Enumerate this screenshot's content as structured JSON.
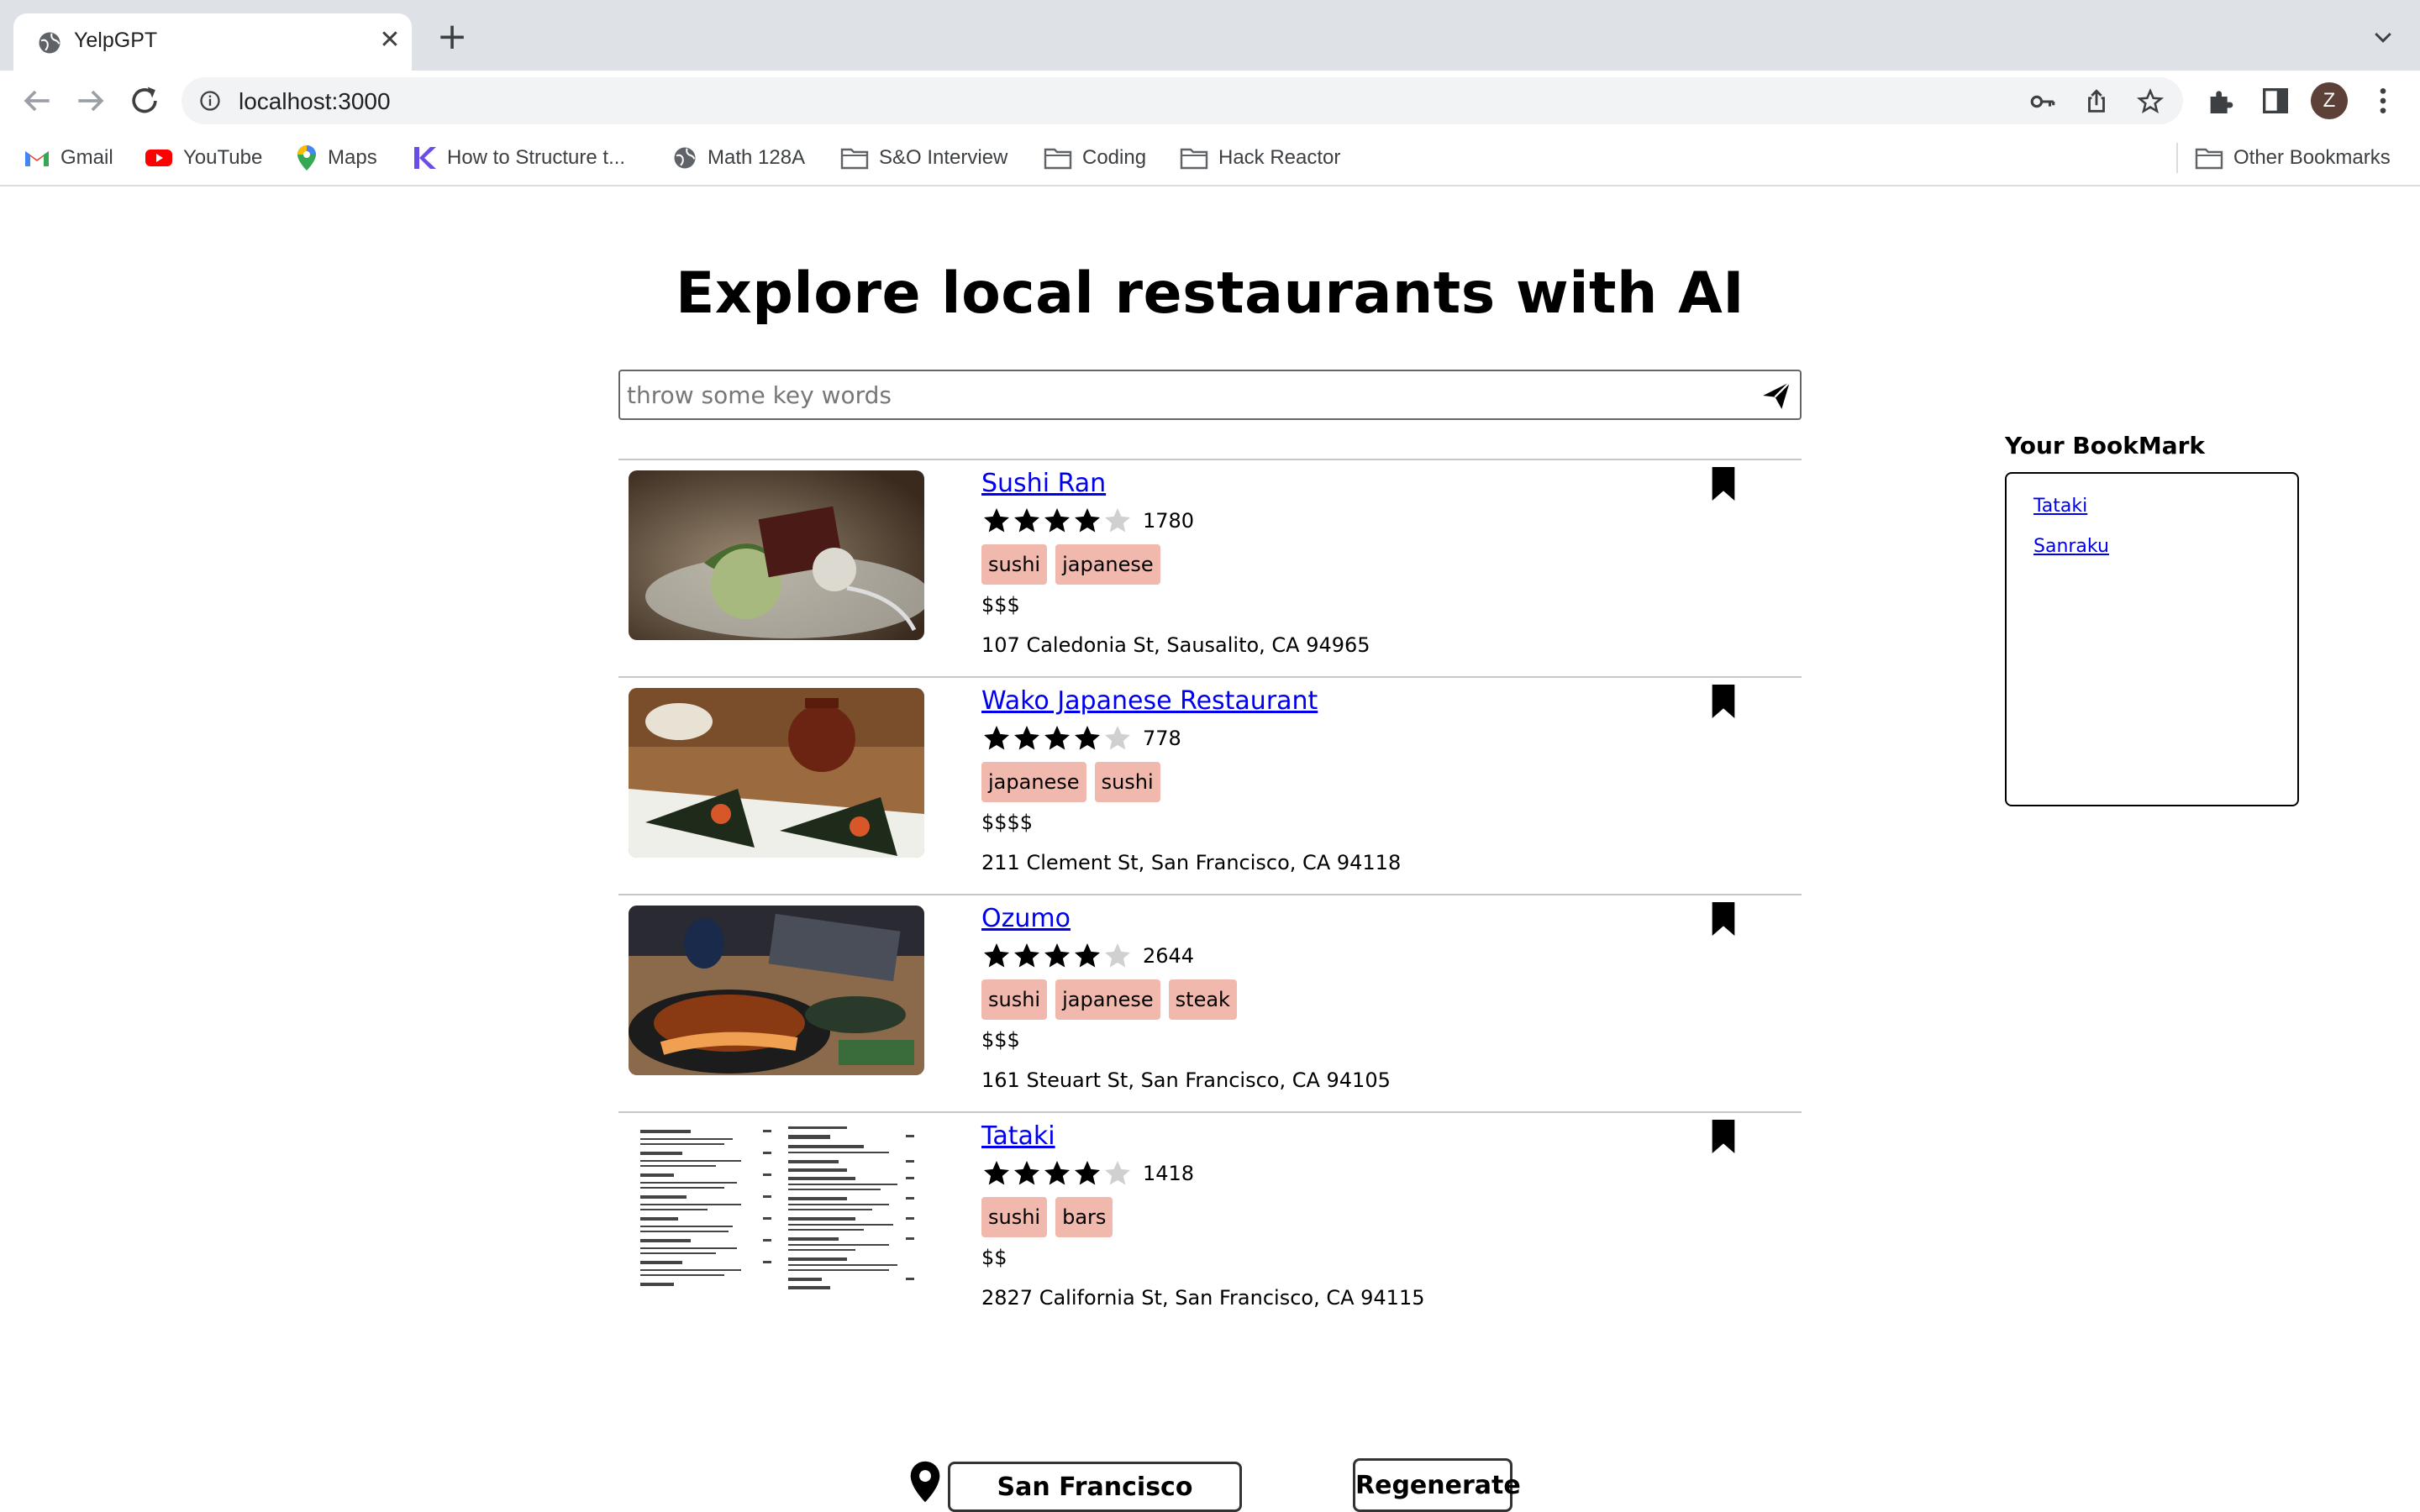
{
  "browser": {
    "tab_title": "YelpGPT",
    "url": "localhost:3000",
    "avatar_letter": "Z",
    "bookmarks": [
      "Gmail",
      "YouTube",
      "Maps",
      "How to Structure t...",
      "Math 128A",
      "S&O Interview",
      "Coding",
      "Hack Reactor"
    ],
    "other_bookmarks": "Other Bookmarks"
  },
  "page": {
    "title": "Explore local restaurants with AI",
    "search_placeholder": "throw some key words"
  },
  "results": [
    {
      "name": "Sushi Ran",
      "rating": 4,
      "reviews": "1780",
      "tags": [
        "sushi",
        "japanese"
      ],
      "price": "$$$",
      "address": "107 Caledonia St, Sausalito, CA 94965",
      "image": "ice-cream-dessert-photo"
    },
    {
      "name": "Wako Japanese Restaurant",
      "rating": 4,
      "reviews": "778",
      "tags": [
        "japanese",
        "sushi"
      ],
      "price": "$$$$",
      "address": "211 Clement St, San Francisco, CA 94118",
      "image": "hand-roll-teapot-photo"
    },
    {
      "name": "Ozumo",
      "rating": 4,
      "reviews": "2644",
      "tags": [
        "sushi",
        "japanese",
        "steak"
      ],
      "price": "$$$",
      "address": "161 Steuart St, San Francisco, CA 94105",
      "image": "tempura-bowl-photo"
    },
    {
      "name": "Tataki",
      "rating": 4,
      "reviews": "1418",
      "tags": [
        "sushi",
        "bars"
      ],
      "price": "$$",
      "address": "2827 California St, San Francisco, CA 94115",
      "image": "menu-photo"
    }
  ],
  "bookmark_panel": {
    "heading": "Your BookMark",
    "items": [
      "Tataki",
      "Sanraku"
    ]
  },
  "footer": {
    "location": "San Francisco",
    "regenerate_label": "Regenerate"
  },
  "colors": {
    "tag_bg": "#f1b8ae",
    "link": "#0000ee",
    "chrome_bg": "#dee1e6"
  }
}
